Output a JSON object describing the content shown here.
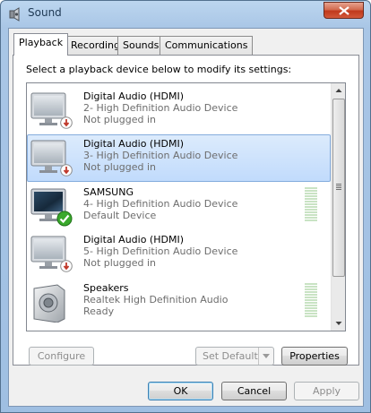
{
  "window": {
    "title": "Sound"
  },
  "tabs": [
    {
      "label": "Playback",
      "active": true
    },
    {
      "label": "Recording",
      "active": false
    },
    {
      "label": "Sounds",
      "active": false
    },
    {
      "label": "Communications",
      "active": false
    }
  ],
  "instructions": "Select a playback device below to modify its settings:",
  "devices": [
    {
      "name": "Digital Audio (HDMI)",
      "line2": "2- High Definition Audio Device",
      "status": "Not plugged in",
      "icon": "monitor-icon",
      "badge": "unplugged-badge",
      "selected": false,
      "meter": false
    },
    {
      "name": "Digital Audio (HDMI)",
      "line2": "3- High Definition Audio Device",
      "status": "Not plugged in",
      "icon": "monitor-icon",
      "badge": "unplugged-badge",
      "selected": true,
      "meter": false
    },
    {
      "name": "SAMSUNG",
      "line2": "4- High Definition Audio Device",
      "status": "Default Device",
      "icon": "monitor-icon",
      "badge": "default-check-badge",
      "selected": false,
      "meter": true
    },
    {
      "name": "Digital Audio (HDMI)",
      "line2": "5- High Definition Audio Device",
      "status": "Not plugged in",
      "icon": "monitor-icon",
      "badge": "unplugged-badge",
      "selected": false,
      "meter": false
    },
    {
      "name": "Speakers",
      "line2": "Realtek High Definition Audio",
      "status": "Ready",
      "icon": "speaker-icon",
      "badge": "",
      "selected": false,
      "meter": true
    }
  ],
  "buttons": {
    "configure": "Configure",
    "set_default": "Set Default",
    "properties": "Properties",
    "ok": "OK",
    "cancel": "Cancel",
    "apply": "Apply"
  },
  "colors": {
    "selection": "#c1dbfc",
    "check_green": "#3aa92c",
    "unplugged_red": "#c0392b",
    "close_red": "#c0391c"
  }
}
